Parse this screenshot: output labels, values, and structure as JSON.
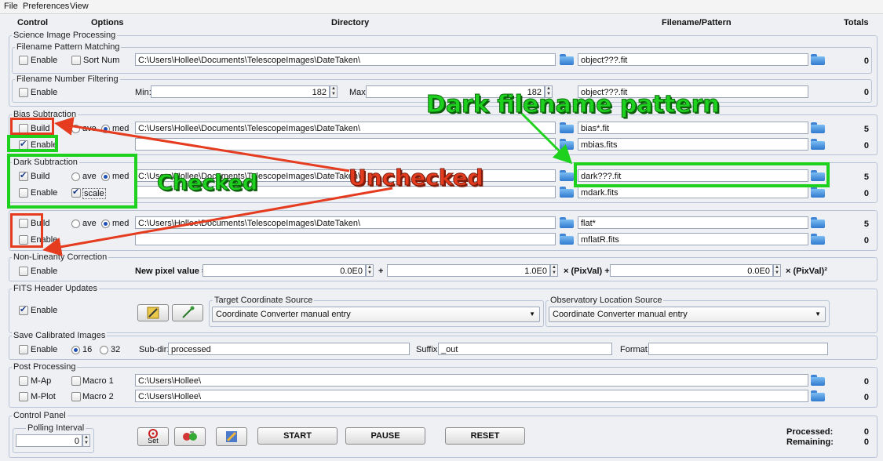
{
  "menu": [
    "File",
    "Preferences",
    "View"
  ],
  "columns": {
    "control": "Control",
    "options": "Options",
    "directory": "Directory",
    "filename": "Filename/Pattern",
    "totals": "Totals"
  },
  "science": {
    "title": "Science Image Processing",
    "pattern_title": "Filename Pattern Matching",
    "enable": "Enable",
    "sortnum": "Sort Num",
    "dir": "C:\\Users\\Hollee\\Documents\\TelescopeImages\\DateTaken\\",
    "pattern": "object???.fit",
    "total": "0",
    "number_title": "Filename Number Filtering",
    "enable2": "Enable",
    "min_label": "Min:",
    "min": "182",
    "max_label": "Max:",
    "max": "182",
    "pattern2": "object???.fit",
    "total2": "0"
  },
  "bias": {
    "title": "Bias Subtraction",
    "build": "Build",
    "ave": "ave",
    "med": "med",
    "enable": "Enable",
    "dir": "C:\\Users\\Hollee\\Documents\\TelescopeImages\\DateTaken\\",
    "pattern": "bias*.fit",
    "master": "mbias.fits",
    "total1": "5",
    "total2": "0"
  },
  "dark": {
    "title": "Dark Subtraction",
    "build": "Build",
    "ave": "ave",
    "med": "med",
    "enable": "Enable",
    "scale": "scale",
    "dir": "C:\\Users\\Hollee\\Documents\\TelescopeImages\\DateTaken\\",
    "pattern": "dark???.fit",
    "master": "mdark.fits",
    "total1": "5",
    "total2": "0"
  },
  "flat": {
    "build": "Build",
    "ave": "ave",
    "med": "med",
    "enable": "Enable",
    "dir": "C:\\Users\\Hollee\\Documents\\TelescopeImages\\DateTaken\\",
    "pattern": "flat*",
    "master": "mflatR.fits",
    "total1": "5",
    "total2": "0"
  },
  "nonlin": {
    "title": "Non-Linearity Correction",
    "enable": "Enable",
    "label": "New pixel value =",
    "v0": "0.0E0",
    "plus1": "+",
    "v1": "1.0E0",
    "mult1": "× (PixVal) +",
    "v2": "0.0E0",
    "mult2": "× (PixVal)²"
  },
  "fits": {
    "title": "FITS Header Updates",
    "enable": "Enable",
    "target_title": "Target Coordinate Source",
    "target_value": "Coordinate Converter manual entry",
    "obs_title": "Observatory Location Source",
    "obs_value": "Coordinate Converter manual entry"
  },
  "save": {
    "title": "Save Calibrated Images",
    "enable": "Enable",
    "r16": "16",
    "r32": "32",
    "subdir_label": "Sub-dir:",
    "subdir": "processed",
    "suffix_label": "Suffix:",
    "suffix": "_out",
    "format_label": "Format:",
    "format": ""
  },
  "post": {
    "title": "Post Processing",
    "map": "M-Ap",
    "macro1": "Macro 1",
    "dir1": "C:\\Users\\Hollee\\",
    "total1": "0",
    "mplot": "M-Plot",
    "macro2": "Macro 2",
    "dir2": "C:\\Users\\Hollee\\",
    "total2": "0"
  },
  "control": {
    "title": "Control Panel",
    "polling_title": "Polling Interval",
    "polling": "0",
    "set": "Set",
    "start": "START",
    "pause": "PAUSE",
    "reset": "RESET",
    "processed_label": "Processed:",
    "processed": "0",
    "remaining_label": "Remaining:",
    "remaining": "0"
  },
  "annotations": {
    "dark_pattern": "Dark filename pattern",
    "checked": "Checked",
    "unchecked": "Unchecked"
  },
  "colors": {
    "annotation_red": "#e53b1f",
    "annotation_green": "#1fd11f"
  }
}
